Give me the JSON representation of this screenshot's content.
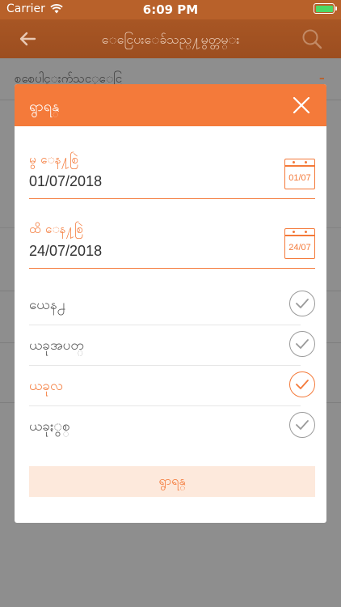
{
  "status_bar": {
    "carrier": "Carrier",
    "time": "6:09 PM",
    "battery_level": 1.0,
    "battery_color": "#4cd964"
  },
  "nav": {
    "title": "ေငြေပးေခ်သည္႔မွတ္တမ္း",
    "back_icon": "arrow-left-icon",
    "search_icon": "search-icon"
  },
  "background": {
    "rows": [
      {
        "label": "စစေပါင္းက်သင့္ေငြ",
        "marker": "-"
      }
    ]
  },
  "modal": {
    "title": "ရွာရန္",
    "close_icon": "close-icon",
    "from_date": {
      "label": "မွ ေန႔စြဲ",
      "value": "01/07/2018",
      "calendar_text": "01/07"
    },
    "to_date": {
      "label": "ထိ ေန႔စြဲ",
      "value": "24/07/2018",
      "calendar_text": "24/07"
    },
    "options": [
      {
        "label": "ယေန႕",
        "checked": false
      },
      {
        "label": "ယခုအပတ္",
        "checked": false
      },
      {
        "label": "ယခုလ",
        "checked": true
      },
      {
        "label": "ယခုႏွစ္",
        "checked": false
      }
    ],
    "search_button": "ရွာရန္"
  },
  "colors": {
    "accent": "#f47a3a",
    "header_dark": "#9c4e20",
    "button_bg": "#fde9dc",
    "check_inactive": "#9a9a9a"
  }
}
